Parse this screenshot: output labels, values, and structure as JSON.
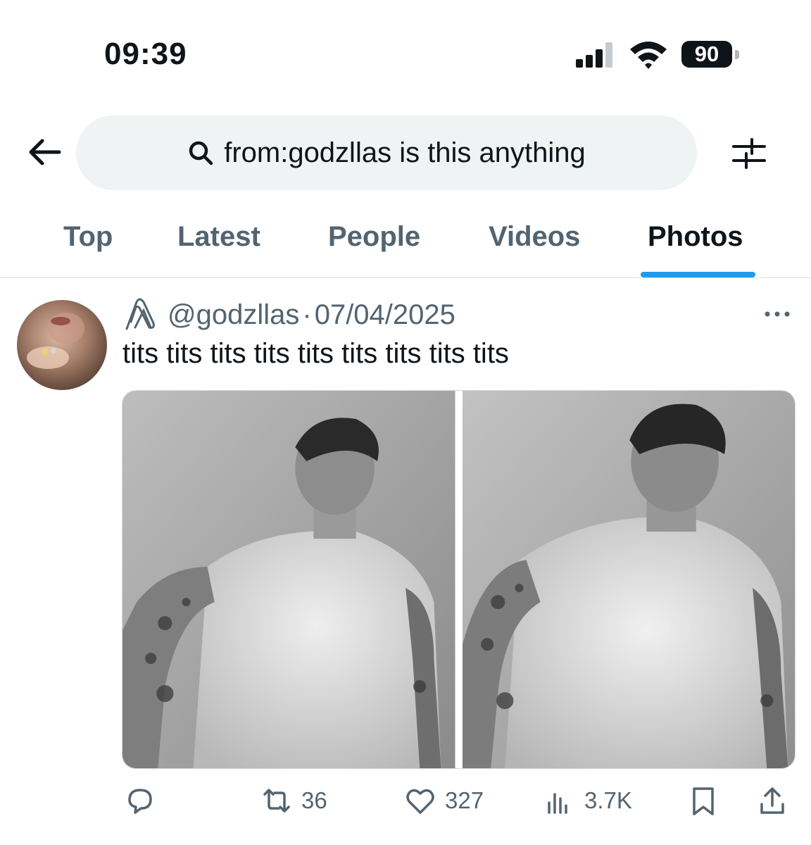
{
  "status_bar": {
    "time": "09:39",
    "battery": "90"
  },
  "search": {
    "query": "from:godzllas is this anything"
  },
  "tabs": [
    {
      "label": "Top"
    },
    {
      "label": "Latest"
    },
    {
      "label": "People"
    },
    {
      "label": "Videos"
    },
    {
      "label": "Photos",
      "active": true
    }
  ],
  "post": {
    "handle": "@godzllas",
    "separator": "·",
    "date": "07/04/2025",
    "text": "tits tits tits tits tits tits tits tits tits",
    "replies": "",
    "reposts": "36",
    "likes": "327",
    "views": "3.7K"
  },
  "colors": {
    "accent": "#1d9bf0",
    "muted": "#536471",
    "search_bg": "#eff3f4"
  }
}
